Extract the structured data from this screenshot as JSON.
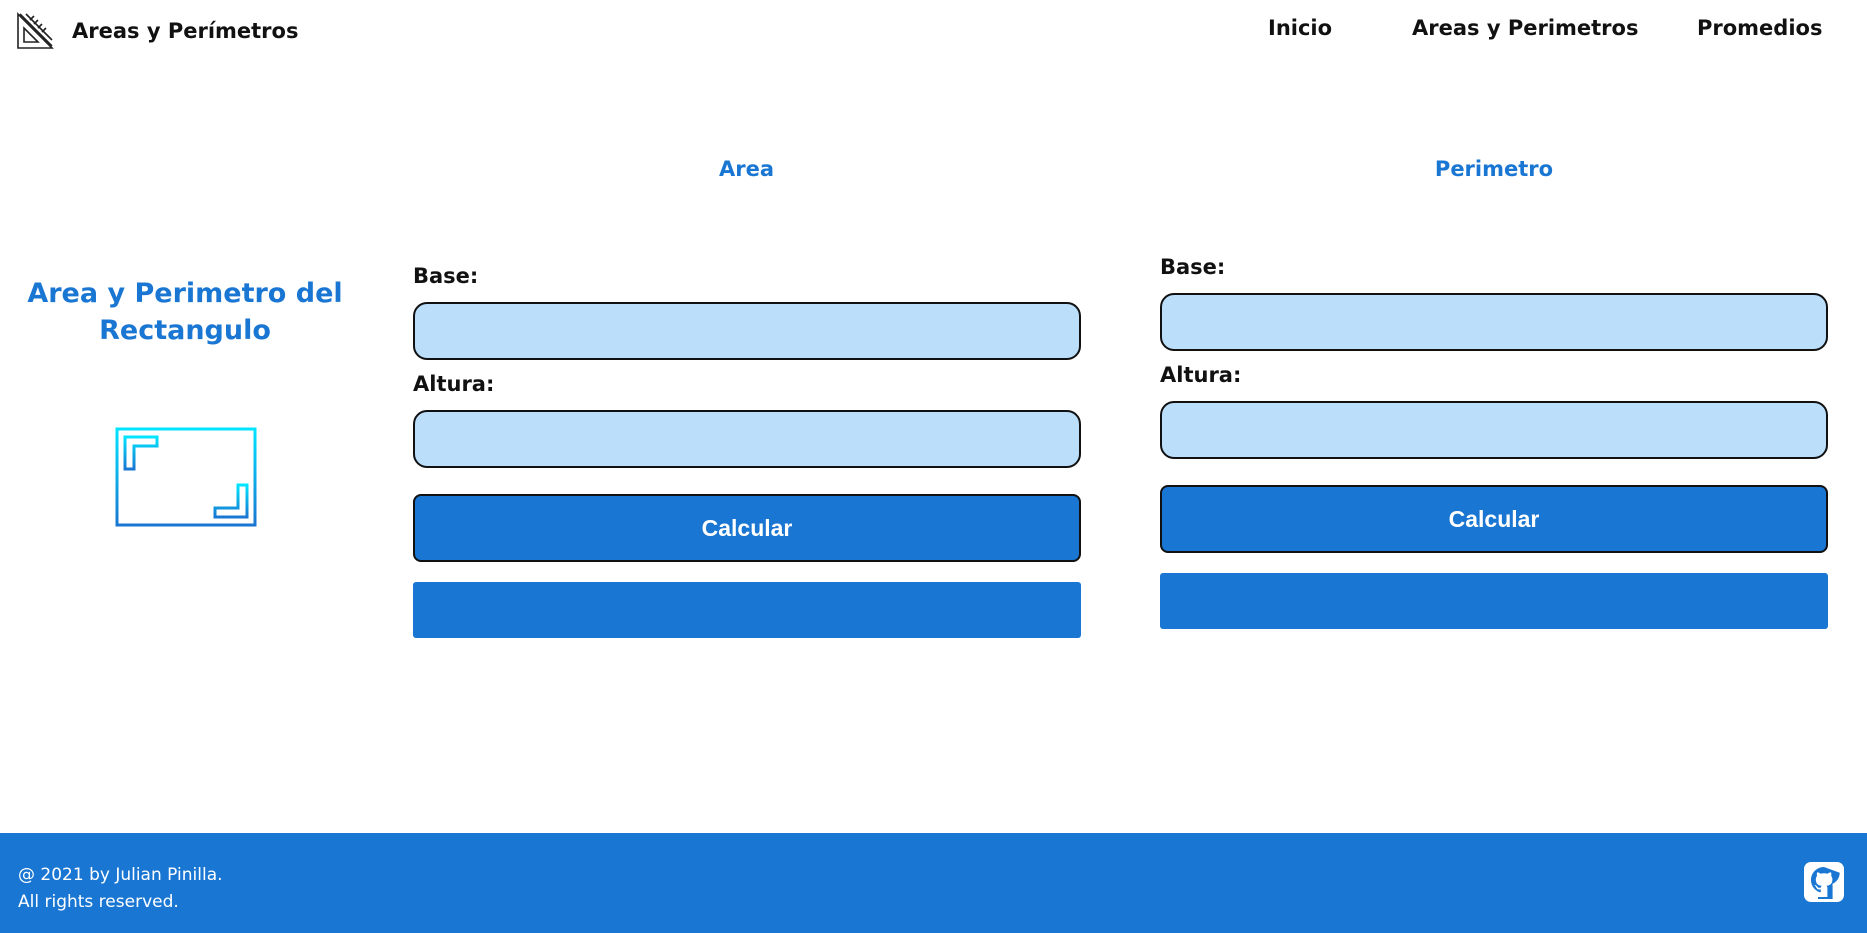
{
  "header": {
    "brand_title": "Areas y Perímetros",
    "logo_icon": "set-square-ruler-icon",
    "nav": [
      {
        "label": "Inicio"
      },
      {
        "label": "Areas y Perimetros"
      },
      {
        "label": "Promedios"
      }
    ]
  },
  "shape_section": {
    "title": "Area y Perimetro del Rectangulo",
    "icon": "rectangle-icon"
  },
  "area": {
    "title": "Area",
    "base_label": "Base:",
    "base_value": "",
    "height_label": "Altura:",
    "height_value": "",
    "button_label": "Calcular",
    "result": ""
  },
  "perimeter": {
    "title": "Perimetro",
    "base_label": "Base:",
    "base_value": "",
    "height_label": "Altura:",
    "height_value": "",
    "button_label": "Calcular",
    "result": ""
  },
  "footer": {
    "line1": "@ 2021 by Julian Pinilla.",
    "line2": "All rights reserved.",
    "github_icon": "github-icon"
  },
  "colors": {
    "accent": "#1976d2",
    "input_bg": "#bbdefb",
    "icon_gradient_start": "#00e5ff",
    "icon_gradient_end": "#1976d2"
  }
}
